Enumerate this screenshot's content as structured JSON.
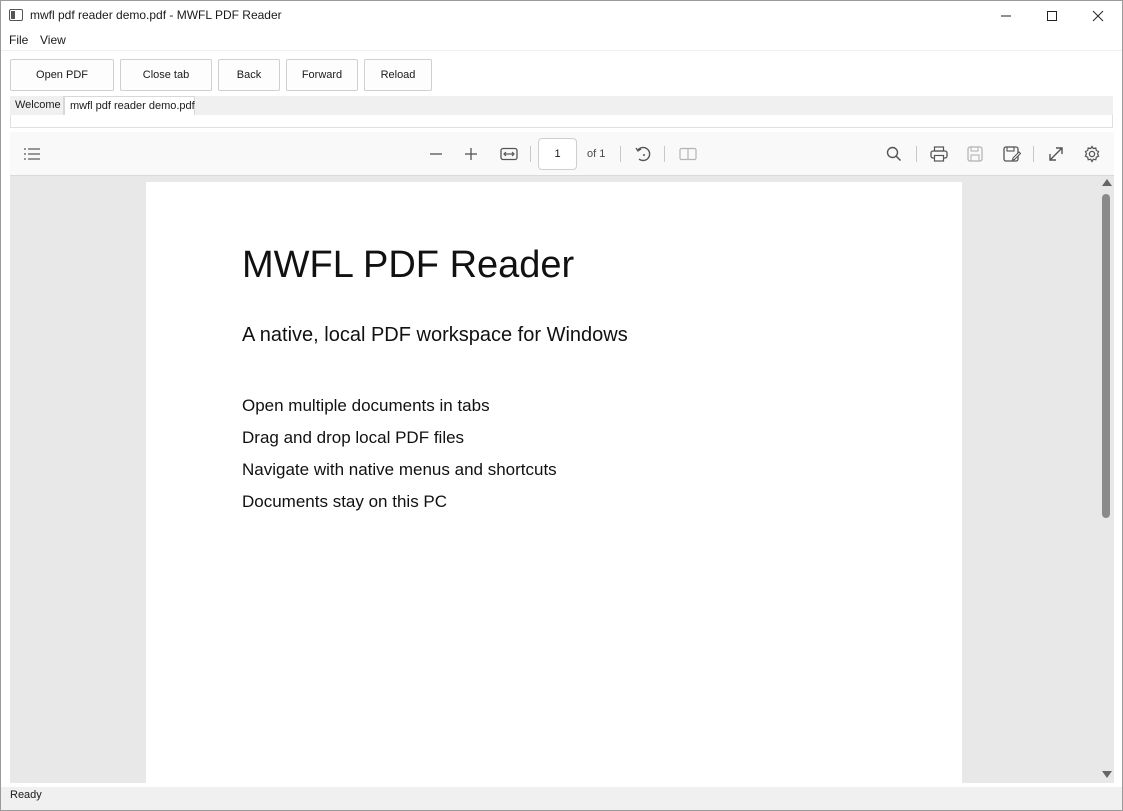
{
  "window": {
    "title": "mwfl pdf reader demo.pdf - MWFL PDF Reader"
  },
  "menu": {
    "file": "File",
    "view": "View"
  },
  "toolbar": {
    "open_label": "Open PDF",
    "close_label": "Close tab",
    "back_label": "Back",
    "forward_label": "Forward",
    "reload_label": "Reload"
  },
  "tabs": [
    {
      "label": "Welcome",
      "active": false
    },
    {
      "label": "mwfl pdf reader demo.pdf",
      "active": true
    }
  ],
  "viewer": {
    "page_number": "1",
    "page_total_text": "of 1",
    "icons": [
      "sidebar-toggle-icon",
      "zoom-out-icon",
      "zoom-in-icon",
      "fit-width-icon",
      "rotate-icon",
      "two-page-icon",
      "search-icon",
      "print-icon",
      "save-icon",
      "save-as-icon",
      "fullscreen-icon",
      "settings-icon"
    ]
  },
  "document": {
    "title": "MWFL PDF Reader",
    "subtitle": "A native, local PDF workspace for Windows",
    "lines": [
      "Open multiple documents in tabs",
      "Drag and drop local PDF files",
      "Navigate with native menus and shortcuts",
      "Documents stay on this PC"
    ]
  },
  "status": {
    "text": "Ready"
  },
  "colors": {
    "viewer_background": "#e8e8e8",
    "toolbar_background": "#f9f9fa",
    "page_background": "#ffffff"
  }
}
